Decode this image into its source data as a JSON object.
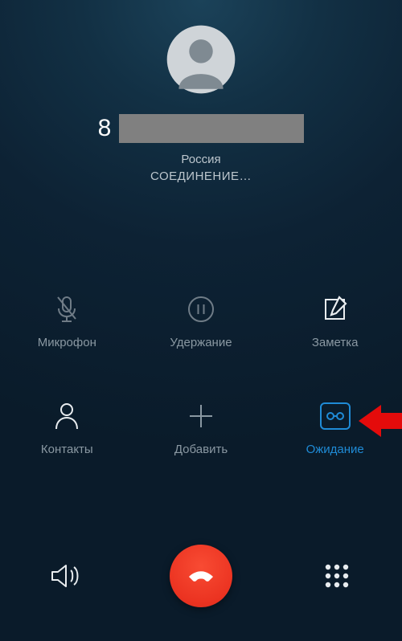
{
  "call": {
    "phone_prefix": "8",
    "region": "Россия",
    "status": "СОЕДИНЕНИЕ…"
  },
  "actions": {
    "mute": {
      "label": "Микрофон",
      "icon": "mic-off-icon",
      "enabled": false,
      "active": false
    },
    "hold": {
      "label": "Удержание",
      "icon": "pause-icon",
      "enabled": false,
      "active": false
    },
    "note": {
      "label": "Заметка",
      "icon": "note-icon",
      "enabled": true,
      "active": false
    },
    "contacts": {
      "label": "Контакты",
      "icon": "person-icon",
      "enabled": true,
      "active": false
    },
    "add": {
      "label": "Добавить",
      "icon": "plus-icon",
      "enabled": true,
      "active": false
    },
    "wait": {
      "label": "Ожидание",
      "icon": "record-icon",
      "enabled": true,
      "active": true
    }
  },
  "bottom": {
    "speaker": "speaker-icon",
    "hangup": "hangup-icon",
    "dialpad": "dialpad-icon"
  },
  "colors": {
    "accent": "#1f8bd6",
    "hangup": "#eb3321",
    "muted_text": "#8a98a2"
  }
}
